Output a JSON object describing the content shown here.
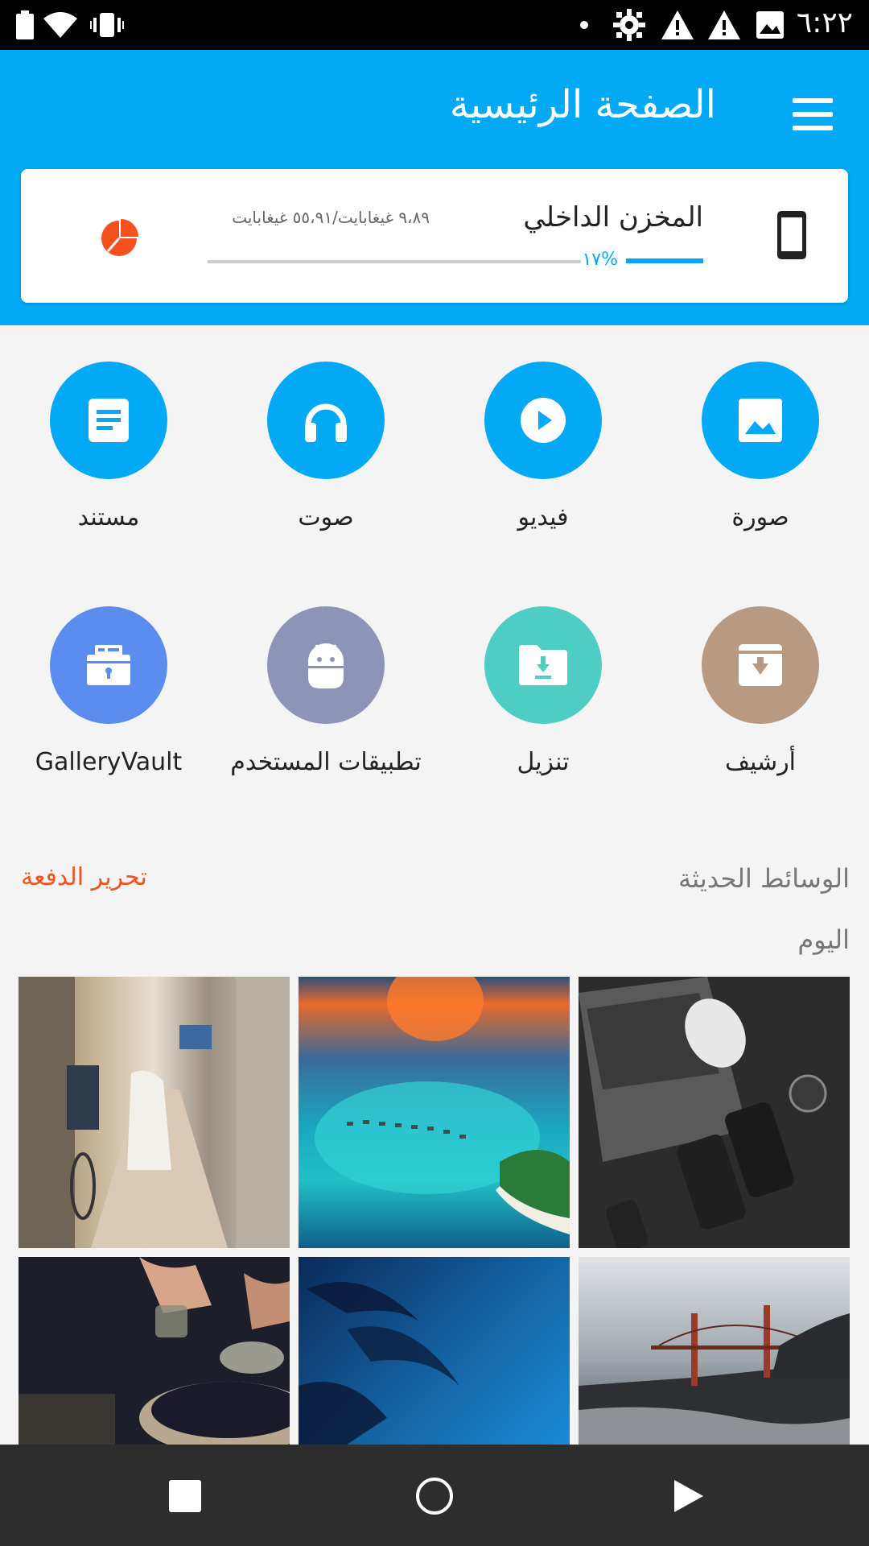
{
  "status_bar": {
    "time": "٦:٢٢",
    "icons": [
      "battery-icon",
      "wifi-icon",
      "vibrate-icon",
      "dot-icon",
      "settings-icon",
      "warning-icon",
      "warning-icon",
      "image-icon"
    ]
  },
  "header": {
    "title": "الصفحة الرئيسية",
    "menu_icon": "hamburger-menu-icon"
  },
  "storage": {
    "title": "المخزن الداخلي",
    "usage": "٩،٨٩ غيغابايت/٥٥،٩١ غيغابايت",
    "percent": "١٧%",
    "used_fraction": 0.17,
    "icon": "phone-icon",
    "action_icon": "pie-chart-icon"
  },
  "categories": [
    {
      "label": "صورة",
      "icon": "image-icon",
      "color": "#03a9f4"
    },
    {
      "label": "فيديو",
      "icon": "play-icon",
      "color": "#03a9f4"
    },
    {
      "label": "صوت",
      "icon": "headphones-icon",
      "color": "#03a9f4"
    },
    {
      "label": "مستند",
      "icon": "document-icon",
      "color": "#03a9f4"
    },
    {
      "label": "أرشيف",
      "icon": "archive-icon",
      "color": "#b89a82"
    },
    {
      "label": "تنزيل",
      "icon": "download-folder-icon",
      "color": "#4ecdc4"
    },
    {
      "label": "تطبيقات المستخدم",
      "icon": "android-icon",
      "color": "#8e94b8"
    },
    {
      "label": "GalleryVault",
      "icon": "vault-icon",
      "color": "#5b8def"
    }
  ],
  "recent": {
    "title": "الوسائط الحديثة",
    "batch_edit": "تحرير الدفعة",
    "group_label": "اليوم"
  },
  "nav": {
    "icons": [
      "back-icon",
      "home-icon",
      "recents-icon"
    ]
  }
}
